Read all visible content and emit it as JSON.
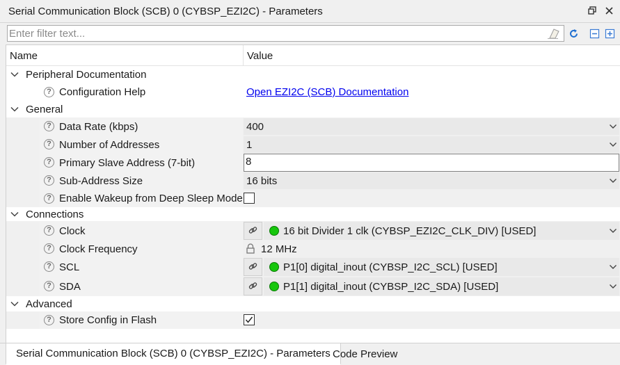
{
  "window": {
    "title": "Serial Communication Block (SCB) 0 (CYBSP_EZI2C) - Parameters"
  },
  "filter": {
    "placeholder": "Enter filter text..."
  },
  "grid": {
    "headers": {
      "name": "Name",
      "value": "Value"
    },
    "sections": {
      "peripheral_docs": "Peripheral Documentation",
      "general": "General",
      "connections": "Connections",
      "advanced": "Advanced"
    },
    "props": {
      "config_help": {
        "name": "Configuration Help",
        "value": "Open EZI2C (SCB) Documentation"
      },
      "data_rate": {
        "name": "Data Rate (kbps)",
        "value": "400"
      },
      "num_addresses": {
        "name": "Number of Addresses",
        "value": "1"
      },
      "primary_slave_addr": {
        "name": "Primary Slave Address (7-bit)",
        "value": "8"
      },
      "sub_address_size": {
        "name": "Sub-Address Size",
        "value": "16 bits"
      },
      "enable_wakeup": {
        "name": "Enable Wakeup from Deep Sleep Mode",
        "checked": false
      },
      "clock": {
        "name": "Clock",
        "value": "16 bit Divider 1 clk (CYBSP_EZI2C_CLK_DIV) [USED]"
      },
      "clock_freq": {
        "name": "Clock Frequency",
        "value": "12 MHz"
      },
      "scl": {
        "name": "SCL",
        "value": "P1[0] digital_inout (CYBSP_I2C_SCL) [USED]"
      },
      "sda": {
        "name": "SDA",
        "value": "P1[1] digital_inout (CYBSP_I2C_SDA) [USED]"
      },
      "store_config": {
        "name": "Store Config in Flash",
        "checked": true
      }
    }
  },
  "tabs": [
    {
      "label": "Serial Communication Block (SCB) 0 (CYBSP_EZI2C) - Parameters",
      "active": true
    },
    {
      "label": "Code Preview",
      "active": false
    }
  ],
  "icons": {
    "help": "?",
    "status_color": "#16c60c",
    "link_color": "#0000ee"
  }
}
